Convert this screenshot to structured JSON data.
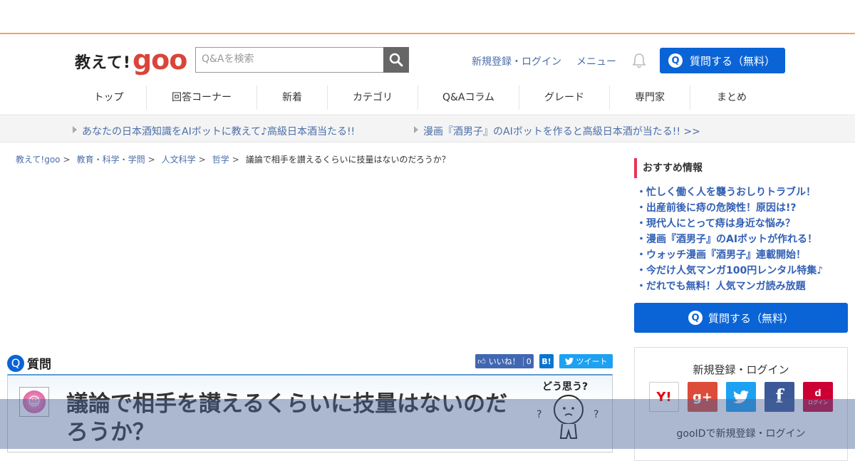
{
  "header": {
    "logo_ja": "教えて!",
    "logo_goo": "goo",
    "search_placeholder": "Q&Aを検索",
    "login_label": "新規登録・ログイン",
    "menu_label": "メニュー",
    "ask_label": "質問する（無料）",
    "q_mark": "Q"
  },
  "nav": [
    "トップ",
    "回答コーナー",
    "新着",
    "カテゴリ",
    "Q&Aコラム",
    "グレード",
    "専門家",
    "まとめ"
  ],
  "promos": [
    "あなたの日本酒知識をAIボットに教えて♪高級日本酒当たる!!",
    "漫画『酒男子』のAIボットを作ると高級日本酒が当たる!! >>"
  ],
  "breadcrumb": {
    "items": [
      "教えて!goo",
      "教育・科学・学問",
      "人文科学",
      "哲学"
    ],
    "separator": ">",
    "current": "議論で相手を讃えるくらいに技量はないのだろうか？"
  },
  "question": {
    "heading": "質問",
    "q_mark": "Q",
    "title": "議論で相手を讃えるくらいに技量はないのだろうか？",
    "doushitsu": "どう思う?",
    "like_label": "いいね！",
    "like_count": "0",
    "hatena_label": "B!",
    "tweet_label": "ツイート"
  },
  "sidebar": {
    "recommend_title": "おすすめ情報",
    "recommend_items": [
      "忙しく働く人を襲うおしりトラブル！",
      "出産前後に痔の危険性！原因は!?",
      "現代人にとって痔は身近な悩み？",
      "漫画『酒男子』のAIボットが作れる！",
      "ウォッチ漫画『酒男子』連載開始！",
      "今だけ人気マンガ100円レンタル特集♪",
      "だれでも無料！人気マンガ読み放題"
    ],
    "ask_label": "質問する（無料）",
    "login_title": "新規登録・ログイン",
    "sns": [
      "Y!",
      "g+",
      "twitter",
      "f",
      "d"
    ],
    "docomo_sub": "ログイン",
    "gooid_label": "gooIDで新規登録・ログイン"
  },
  "colors": {
    "accent_blue": "#0a64d6",
    "link_blue": "#4a6ea8",
    "goo_red": "#d9453a",
    "header_orange": "#f7a25d",
    "recommend_pink": "#e8345a"
  }
}
